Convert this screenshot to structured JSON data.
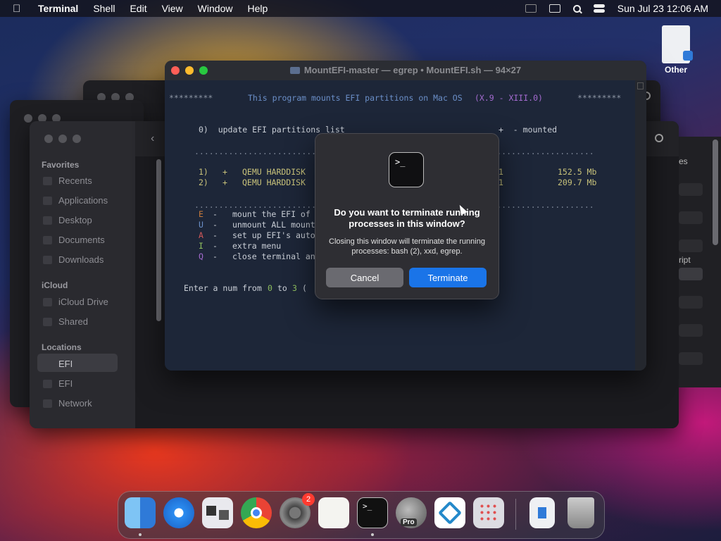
{
  "menubar": {
    "app": "Terminal",
    "items": [
      "Shell",
      "Edit",
      "View",
      "Window",
      "Help"
    ],
    "clock": "Sun Jul 23  12:06 AM"
  },
  "desktop": {
    "file_label": "Other"
  },
  "finder": {
    "sections": {
      "favorites": "Favorites",
      "icloud": "iCloud",
      "locations": "Locations"
    },
    "favorites": [
      "Recents",
      "Applications",
      "Desktop",
      "Documents",
      "Downloads"
    ],
    "icloud": [
      "iCloud Drive",
      "Shared"
    ],
    "locations": [
      "EFI",
      "EFI",
      "Network"
    ],
    "right_fragments": [
      "es",
      "ript"
    ]
  },
  "terminal": {
    "title": "MountEFI-master — egrep • MountEFI.sh — 94×27",
    "header_stars_left": "*********",
    "header_text": "This program mounts EFI partitions on Mac OS",
    "header_version": "(X.9 - XIII.0)",
    "header_stars_right": "*********",
    "update_line": "0)  update EFI partitions list",
    "mounted_legend": "+  - mounted",
    "dots_line": "..................................................................................",
    "disks": [
      {
        "num": "1)",
        "mark": "+",
        "name": "QEMU HARDDISK",
        "idx": "1",
        "size": "152.5 Mb"
      },
      {
        "num": "2)",
        "mark": "+",
        "name": "QEMU HARDDISK",
        "idx": "1",
        "size": "209.7 Mb"
      }
    ],
    "menu": [
      {
        "key": "E",
        "text": "mount the EFI of"
      },
      {
        "key": "U",
        "text": "unmount ALL mount"
      },
      {
        "key": "A",
        "text": "set up EFI's auto"
      },
      {
        "key": "I",
        "text": "extra menu"
      },
      {
        "key": "Q",
        "text": "close terminal an"
      }
    ],
    "prompt_prefix": "Enter a num from",
    "prompt_from": "0",
    "prompt_to": "to",
    "prompt_max": "3",
    "prompt_tail": "( "
  },
  "dialog": {
    "heading": "Do you want to terminate running processes in this window?",
    "message": "Closing this window will terminate the running processes: bash (2), xxd, egrep.",
    "cancel": "Cancel",
    "confirm": "Terminate",
    "icon_glyph": ">_"
  },
  "dock": {
    "settings_badge": "2",
    "terminal_glyph": ">_",
    "pro_label": "Pro"
  }
}
